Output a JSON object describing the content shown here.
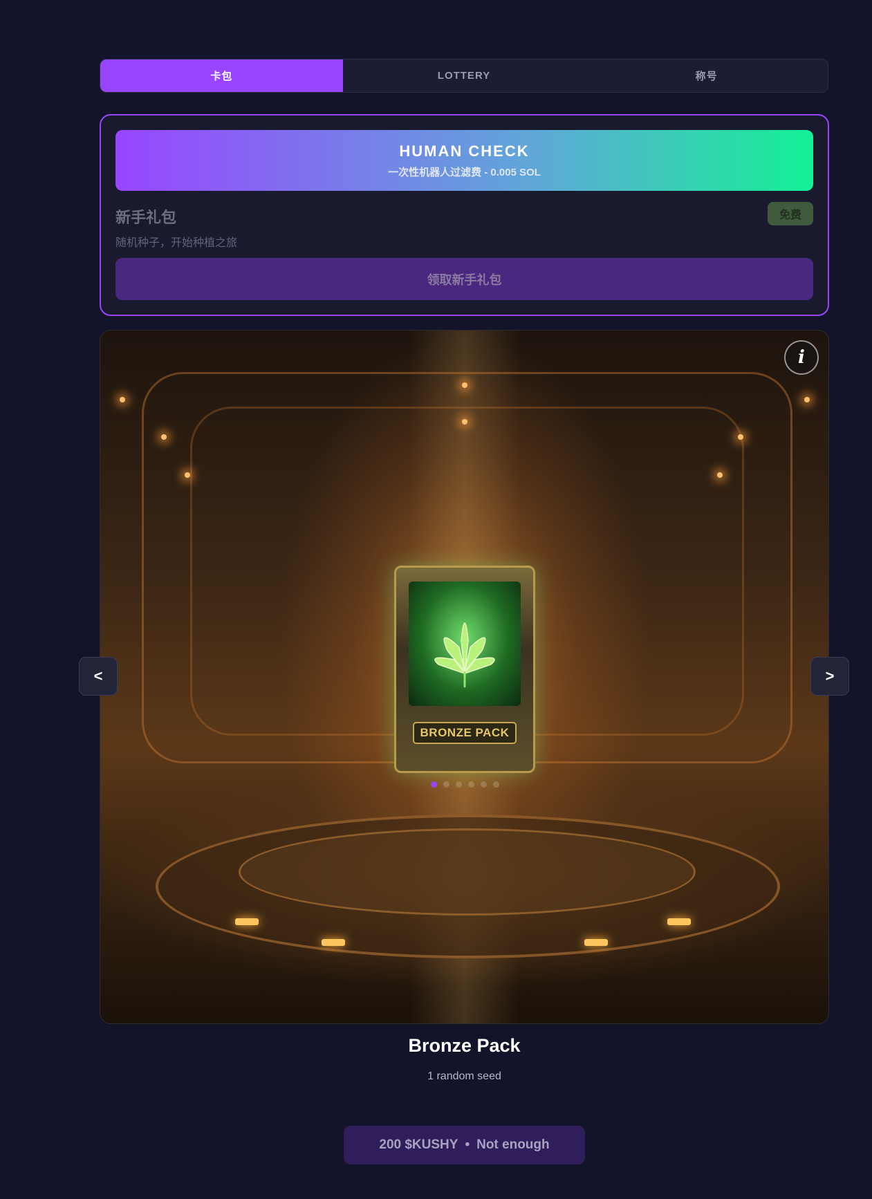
{
  "tabs": [
    {
      "label": "卡包",
      "active": true
    },
    {
      "label": "LOTTERY",
      "active": false
    },
    {
      "label": "称号",
      "active": false
    }
  ],
  "starter": {
    "human_check_title": "HUMAN CHECK",
    "human_check_subtitle": "一次性机器人过滤费 - 0.005 SOL",
    "title": "新手礼包",
    "description": "随机种子，开始种植之旅",
    "badge": "免费",
    "claim_label": "领取新手礼包"
  },
  "showcase": {
    "info_label": "i",
    "prev_label": "<",
    "next_label": ">",
    "pack_card_label": "BRONZE PACK",
    "carousel_dots": 6,
    "active_dot": 0
  },
  "pack": {
    "name": "Bronze Pack",
    "description": "1 random seed",
    "price": "200 $KUSHY",
    "separator": "•",
    "status": "Not enough"
  },
  "colors": {
    "accent": "#9945ff",
    "gradient_end": "#14f195",
    "background": "#13142a"
  }
}
